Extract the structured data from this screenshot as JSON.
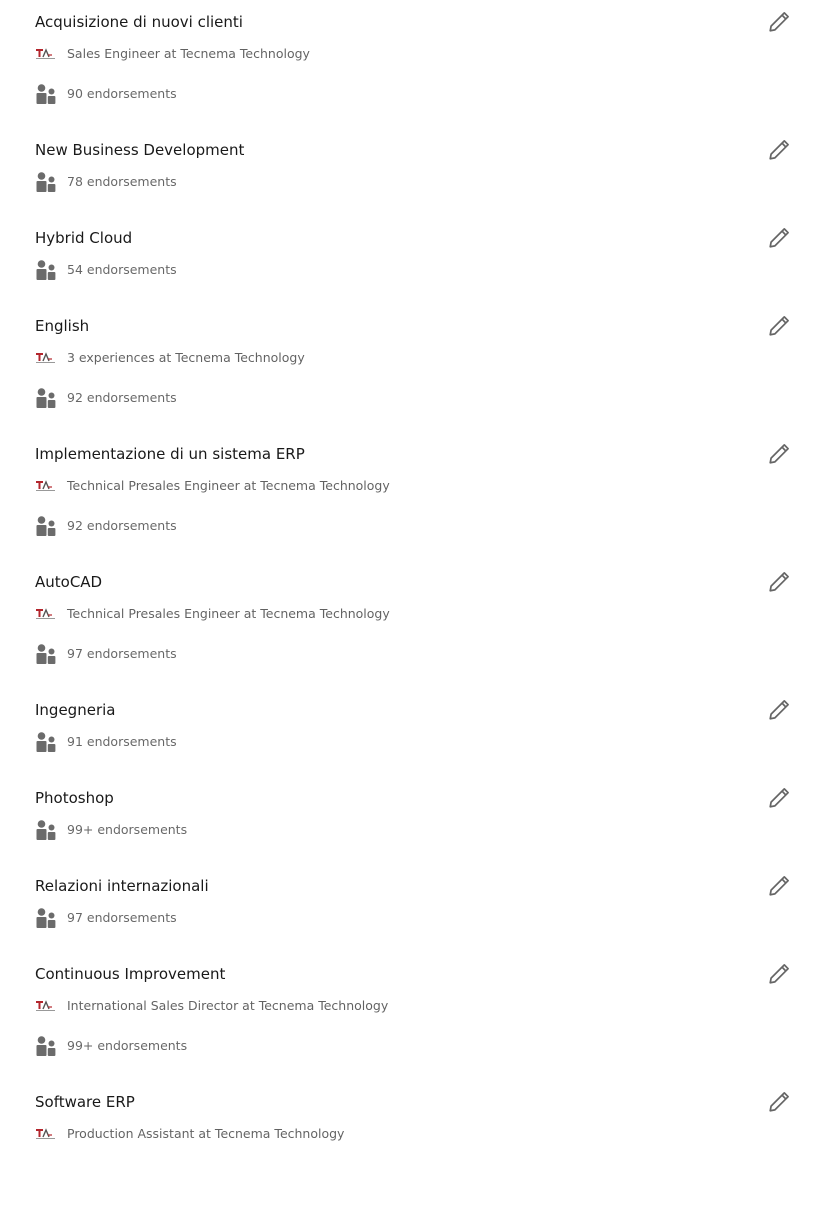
{
  "colors": {
    "title_text": "#1f1f1f",
    "meta_text": "#666666",
    "icon_gray": "#6b6b6b",
    "logo_red": "#b3262d"
  },
  "skills": [
    {
      "title": "Acquisizione di nuovi clienti",
      "experience": "Sales Engineer at Tecnema Technology",
      "endorsements": "90 endorsements"
    },
    {
      "title": "New Business Development",
      "experience": null,
      "endorsements": "78 endorsements"
    },
    {
      "title": "Hybrid Cloud",
      "experience": null,
      "endorsements": "54 endorsements"
    },
    {
      "title": "English",
      "experience": "3 experiences at Tecnema Technology",
      "endorsements": "92 endorsements"
    },
    {
      "title": "Implementazione di un sistema ERP",
      "experience": "Technical Presales Engineer at Tecnema Technology",
      "endorsements": "92 endorsements"
    },
    {
      "title": "AutoCAD",
      "experience": "Technical Presales Engineer at Tecnema Technology",
      "endorsements": "97 endorsements"
    },
    {
      "title": "Ingegneria",
      "experience": null,
      "endorsements": "91 endorsements"
    },
    {
      "title": "Photoshop",
      "experience": null,
      "endorsements": "99+ endorsements"
    },
    {
      "title": "Relazioni internazionali",
      "experience": null,
      "endorsements": "97 endorsements"
    },
    {
      "title": "Continuous Improvement",
      "experience": "International Sales Director at Tecnema Technology",
      "endorsements": "99+ endorsements"
    },
    {
      "title": "Software ERP",
      "experience": "Production Assistant at Tecnema Technology",
      "endorsements": null
    }
  ]
}
